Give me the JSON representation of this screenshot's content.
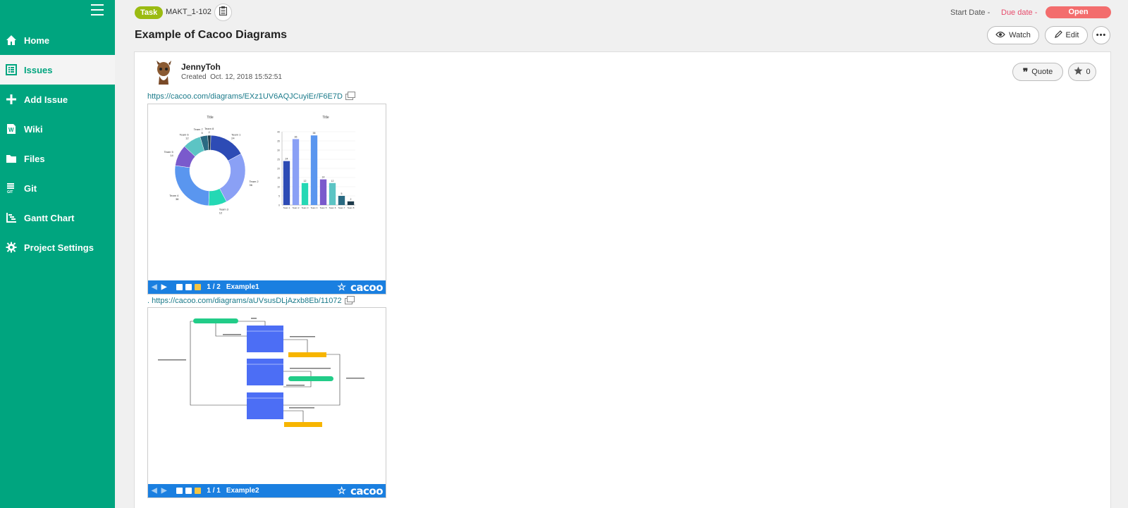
{
  "sidebar": {
    "items": [
      {
        "label": "Home",
        "icon": "home-icon"
      },
      {
        "label": "Issues",
        "icon": "list-icon"
      },
      {
        "label": "Add Issue",
        "icon": "plus-icon"
      },
      {
        "label": "Wiki",
        "icon": "wiki-icon"
      },
      {
        "label": "Files",
        "icon": "folder-icon"
      },
      {
        "label": "Git",
        "icon": "git-icon"
      },
      {
        "label": "Gantt Chart",
        "icon": "gantt-icon"
      },
      {
        "label": "Project Settings",
        "icon": "gear-icon"
      }
    ],
    "active": "Issues",
    "accent": "#00a57f"
  },
  "header": {
    "badge": "Task",
    "issue_key": "MAKT_1-102",
    "title": "Example of Cacoo Diagrams",
    "start_date_label": "Start Date",
    "start_date_value": "-",
    "due_date_label": "Due date",
    "due_date_value": "-",
    "status": "Open",
    "watch_label": "Watch",
    "edit_label": "Edit"
  },
  "comment": {
    "author": "JennyToh",
    "created_label": "Created",
    "created_at": "Oct. 12, 2018 15:52:51",
    "quote_label": "Quote",
    "star_count": "0"
  },
  "embeds": [
    {
      "prefix": "",
      "url": "https://cacoo.com/diagrams/EXz1UV6AQJCuyiEr/F6E7D",
      "page": "1 / 2",
      "sheet": "Example1",
      "logo": "cacoo"
    },
    {
      "prefix": ".",
      "url": "https://cacoo.com/diagrams/aUVsusDLjAzxb8Eb/11072",
      "page": "1 / 1",
      "sheet": "Example2",
      "logo": "cacoo"
    }
  ],
  "chart_data": [
    {
      "type": "pie",
      "title": "Title",
      "categories": [
        "Team 1",
        "Team 2",
        "Team 3",
        "Team 4",
        "Team 5",
        "Team 6",
        "Team 7",
        "Team 8"
      ],
      "values": [
        24,
        36,
        12,
        38,
        14,
        12,
        5,
        2
      ],
      "colors": [
        "#2d4bb5",
        "#8aa0f5",
        "#24d8b4",
        "#5a96ef",
        "#7a5acc",
        "#5cc4c4",
        "#2a6a82",
        "#1e3a4a"
      ]
    },
    {
      "type": "bar",
      "title": "Title",
      "categories": [
        "Team 1",
        "Team 2",
        "Team 3",
        "Team 4",
        "Team 5",
        "Team 6",
        "Team 7",
        "Team 8"
      ],
      "values": [
        24,
        36,
        12,
        38,
        14,
        12,
        5,
        2
      ],
      "ylim": [
        0,
        40
      ],
      "colors": [
        "#2d4bb5",
        "#8aa0f5",
        "#24d8b4",
        "#5a96ef",
        "#7a5acc",
        "#5cc4c4",
        "#2a6a82",
        "#1e3a4a"
      ]
    }
  ]
}
